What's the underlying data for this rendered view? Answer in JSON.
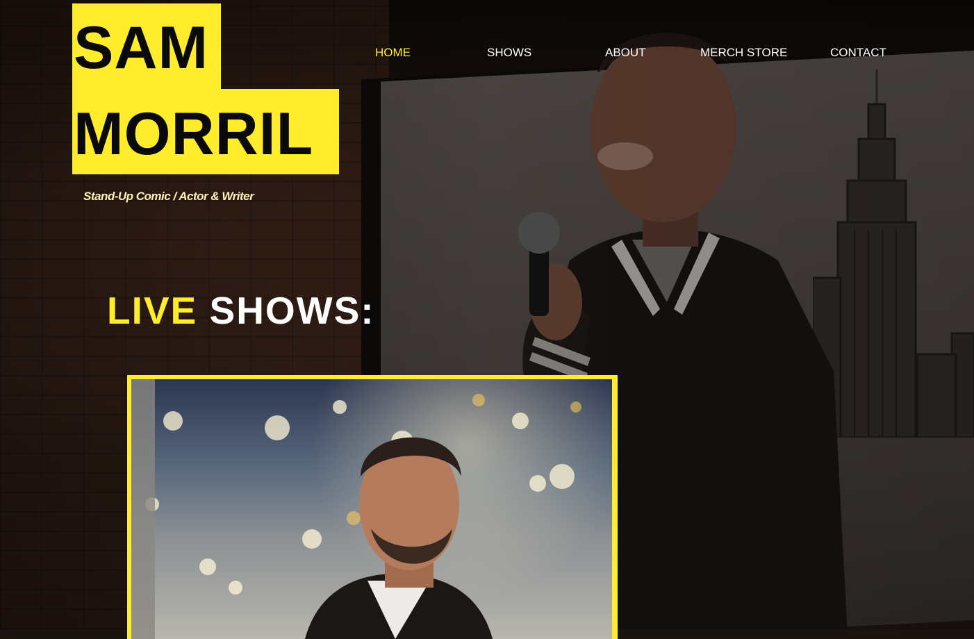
{
  "logo": {
    "line1": "SAM",
    "line2": "MORRIL",
    "tagline": "Stand-Up Comic /  Actor & Writer"
  },
  "nav": {
    "items": [
      {
        "label": "HOME",
        "active": true
      },
      {
        "label": "SHOWS",
        "active": false
      },
      {
        "label": "ABOUT",
        "active": false
      },
      {
        "label": "MERCH STORE",
        "active": false
      },
      {
        "label": "CONTACT",
        "active": false
      }
    ]
  },
  "live_shows": {
    "word1": "LIVE",
    "word2": "SHOWS:"
  },
  "colors": {
    "accent": "#ffec2d",
    "text": "#ffffff",
    "logo_text": "#0a0a0a"
  }
}
